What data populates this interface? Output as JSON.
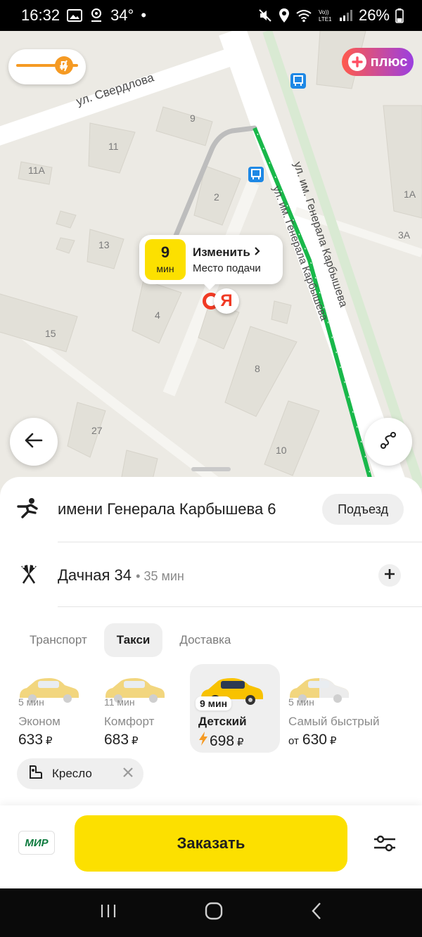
{
  "status_bar": {
    "time": "16:32",
    "temperature": "34°",
    "dot": "•",
    "battery": "26%"
  },
  "map": {
    "streets": {
      "sverdlova": "ул. Свердлова",
      "karbysheva_right": "ул. им. Генерала Карбышева",
      "karbysheva_route": "ул. им. Генерала Карбышева"
    },
    "buildings": [
      "9",
      "11",
      "11А",
      "2",
      "13",
      "1А",
      "3А",
      "4",
      "15",
      "8",
      "27",
      "10"
    ],
    "pickup": {
      "eta_value": "9",
      "eta_unit": "мин",
      "action": "Изменить",
      "caption": "Место подачи"
    },
    "yandex_letter": "Я",
    "plus_label": "плюс",
    "route_color": "#19b84a"
  },
  "route": {
    "from": {
      "address": "имени Генерала Карбышева 6",
      "entrance_label": "Подъезд"
    },
    "to": {
      "address": "Дачная 34",
      "duration": "35 мин"
    }
  },
  "tabs": [
    {
      "label": "Транспорт",
      "active": false
    },
    {
      "label": "Такси",
      "active": true
    },
    {
      "label": "Доставка",
      "active": false
    }
  ],
  "tariffs": [
    {
      "eta": "5 мин",
      "name": "Эконом",
      "price": "633",
      "currency": "₽",
      "prefix": "",
      "active": false
    },
    {
      "eta": "11 мин",
      "name": "Комфорт",
      "price": "683",
      "currency": "₽",
      "prefix": "",
      "active": false
    },
    {
      "eta": "9 мин",
      "name": "Детский",
      "price": "698",
      "currency": "₽",
      "prefix": "",
      "active": true
    },
    {
      "eta": "5 мин",
      "name": "Самый быстрый",
      "price": "630",
      "currency": "₽",
      "prefix": "от",
      "active": false
    }
  ],
  "option_chip": {
    "label": "Кресло"
  },
  "payment": {
    "card_label": "МИР"
  },
  "order_button": "Заказать",
  "colors": {
    "accent_yellow": "#fce000",
    "yandex_red": "#f03a24"
  }
}
